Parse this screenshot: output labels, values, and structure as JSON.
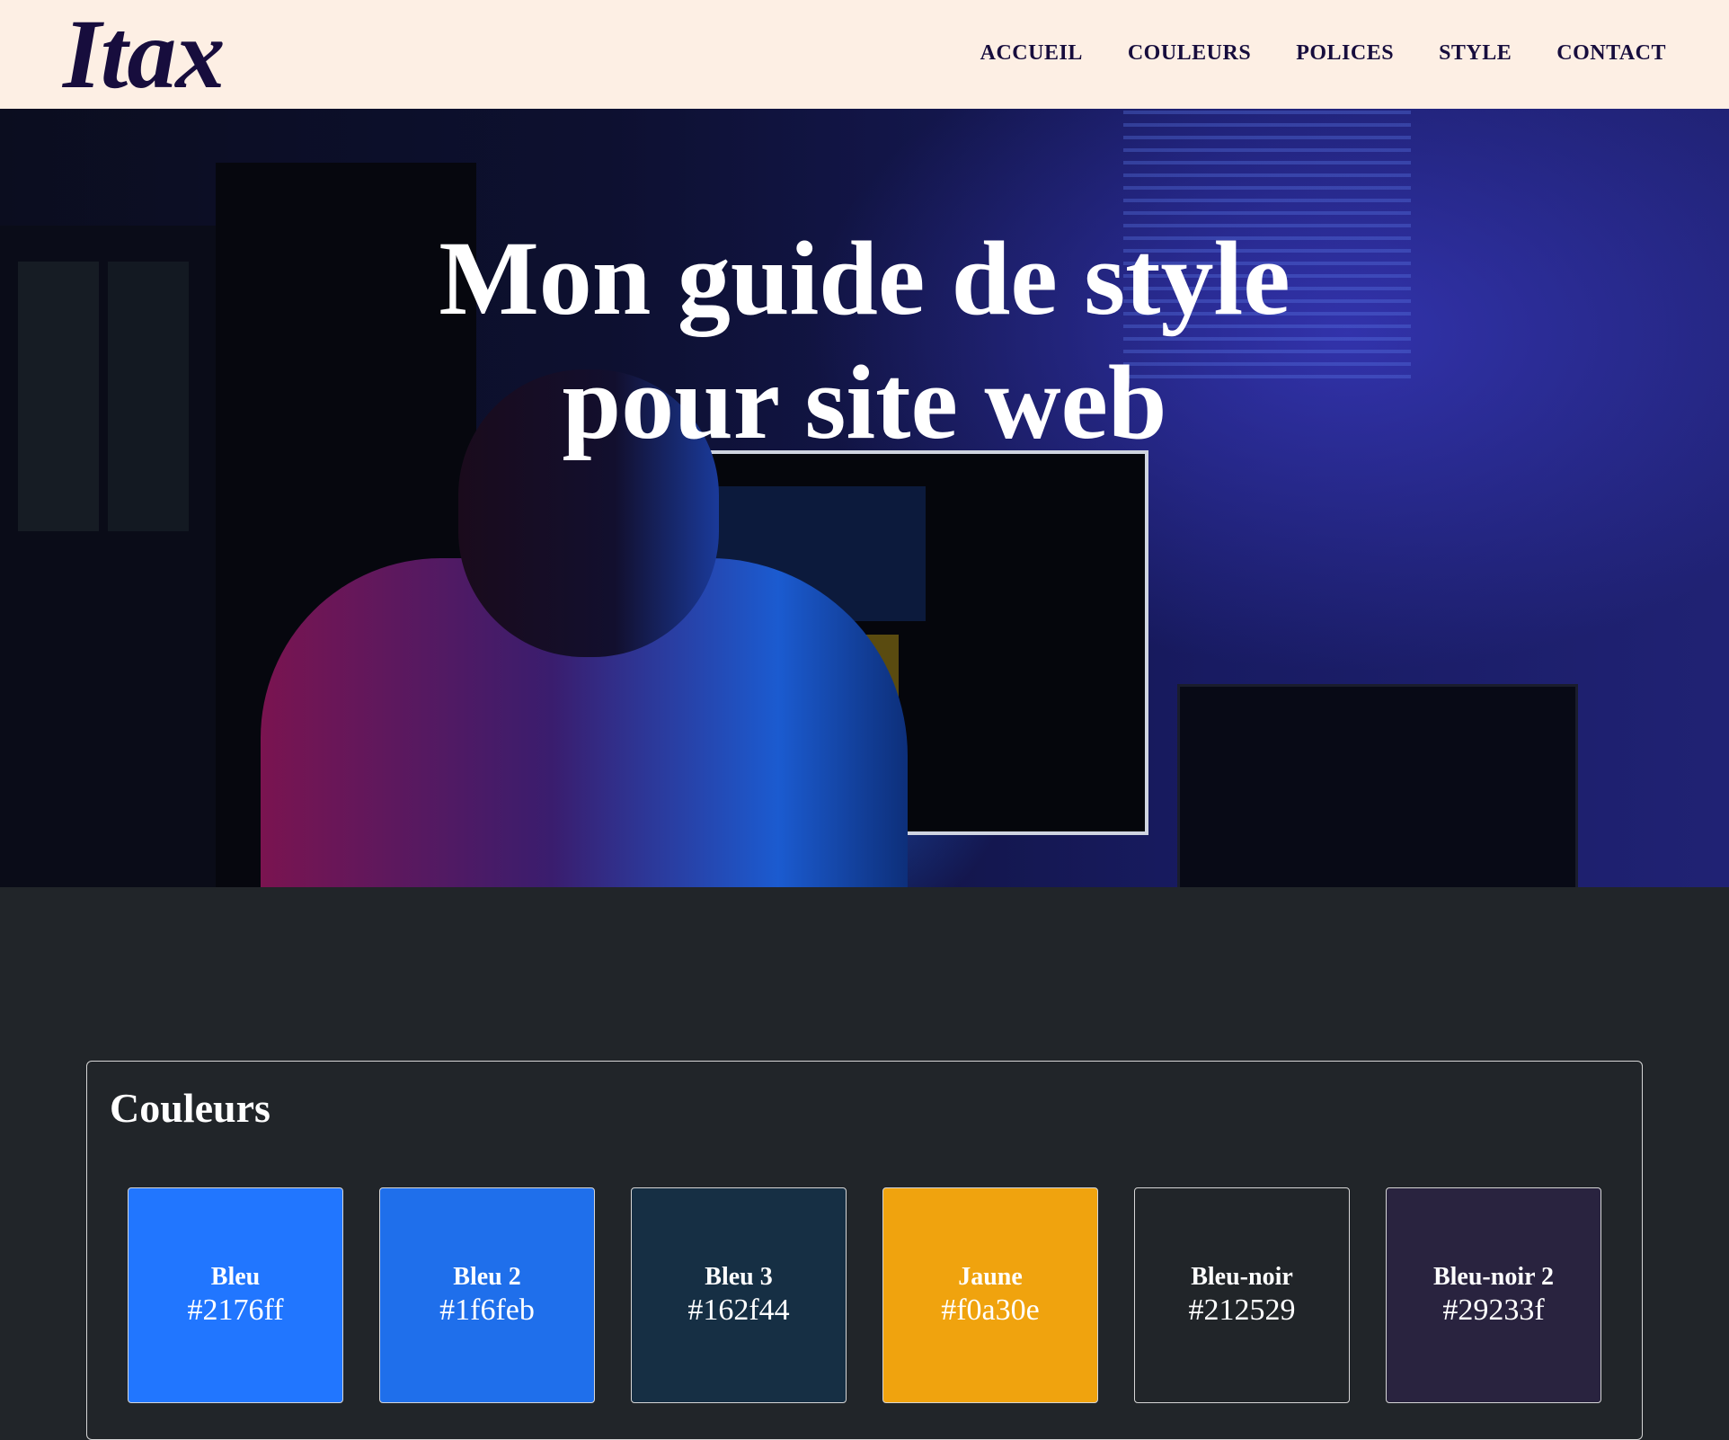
{
  "navbar": {
    "brand": "Itax",
    "links": [
      "ACCUEIL",
      "COULEURS",
      "POLICES",
      "STYLE",
      "CONTACT"
    ]
  },
  "hero": {
    "title_line1": "Mon guide de style",
    "title_line2": "pour site web"
  },
  "colors": {
    "title": "Couleurs",
    "swatches": [
      {
        "name": "Bleu",
        "hex": "#2176ff",
        "color": "#2176ff"
      },
      {
        "name": "Bleu 2",
        "hex": "#1f6feb",
        "color": "#1f6feb"
      },
      {
        "name": "Bleu 3",
        "hex": "#162f44",
        "color": "#162f44"
      },
      {
        "name": "Jaune",
        "hex": "#f0a30e",
        "color": "#f0a30e"
      },
      {
        "name": "Bleu-noir",
        "hex": "#212529",
        "color": "#212529"
      },
      {
        "name": "Bleu-noir 2",
        "hex": "#29233f",
        "color": "#29233f"
      }
    ]
  }
}
